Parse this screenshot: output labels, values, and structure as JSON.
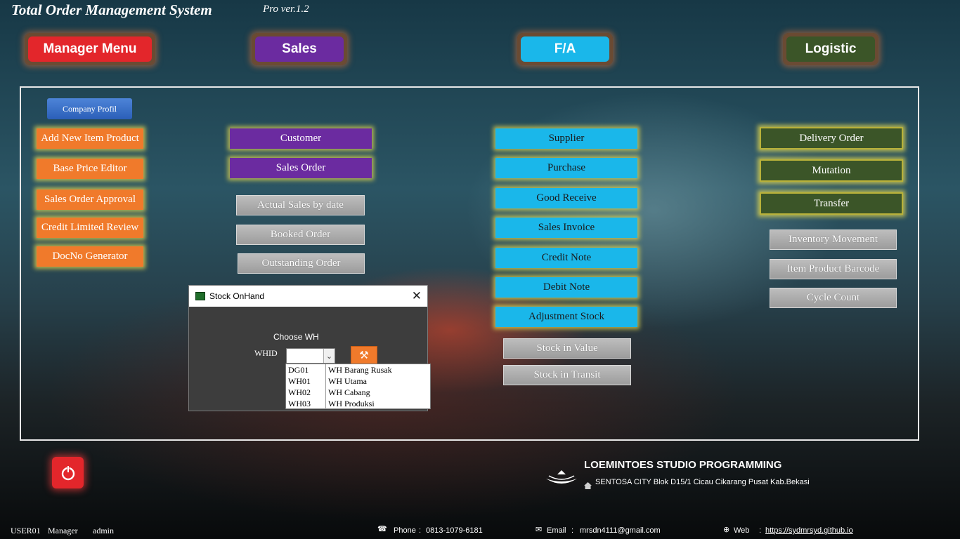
{
  "header": {
    "title": "Total Order Management System",
    "version": "Pro ver.1.2"
  },
  "menus": {
    "manager": "Manager Menu",
    "sales": "Sales",
    "fa": "F/A",
    "logistic": "Logistic"
  },
  "manager_buttons": {
    "company_profil": "Company Profil",
    "add_item": "Add New Item Product",
    "base_price": "Base Price Editor",
    "so_approval": "Sales Order Approval",
    "credit_review": "Credit Limited Review",
    "docno": "DocNo Generator"
  },
  "sales_buttons": {
    "customer": "Customer",
    "sales_order": "Sales Order",
    "actual_sales": "Actual Sales by date",
    "booked_order": "Booked Order",
    "outstanding_order": "Outstanding Order"
  },
  "fa_buttons": {
    "supplier": "Supplier",
    "purchase": "Purchase",
    "good_receive": "Good Receive",
    "sales_invoice": "Sales Invoice",
    "credit_note": "Credit Note",
    "debit_note": "Debit Note",
    "adjustment_stock": "Adjustment Stock",
    "stock_value": "Stock in Value",
    "stock_transit": "Stock in Transit"
  },
  "logistic_buttons": {
    "delivery_order": "Delivery Order",
    "mutation": "Mutation",
    "transfer": "Transfer",
    "inventory_movement": "Inventory Movement",
    "item_barcode": "Item Product Barcode",
    "cycle_count": "Cycle Count"
  },
  "dialog": {
    "title": "Stock OnHand",
    "choose_label": "Choose WH",
    "whid_label": "WHID",
    "whid_value": "",
    "options": [
      {
        "code": "DG01",
        "name": "WH Barang Rusak"
      },
      {
        "code": "WH01",
        "name": "WH Utama"
      },
      {
        "code": "WH02",
        "name": "WH Cabang"
      },
      {
        "code": "WH03",
        "name": "WH Produksi"
      }
    ]
  },
  "studio": {
    "name": "LOEMINTOES STUDIO PROGRAMMING",
    "address": "SENTOSA CITY Blok D15/1 Cicau Cikarang Pusat Kab.Bekasi"
  },
  "footer": {
    "user_id": "USER01",
    "role": "Manager",
    "username": "admin",
    "phone_label": "Phone",
    "phone_value": "0813-1079-6181",
    "email_label": "Email",
    "email_value": "mrsdn4111@gmail.com",
    "web_label": "Web",
    "web_value": "https://sydmrsyd.github.io"
  },
  "colors": {
    "orange": "#f07a2b",
    "purple": "#6b2ba0",
    "cyan": "#1ab7ea",
    "olive": "#3b5528",
    "manager_red": "#e3262b"
  },
  "icons": {
    "power": "power-icon",
    "phone": "phone-icon",
    "email": "email-icon",
    "web": "globe-icon",
    "home": "home-icon",
    "tool": "tools-icon",
    "dialog_app": "excel-icon"
  }
}
